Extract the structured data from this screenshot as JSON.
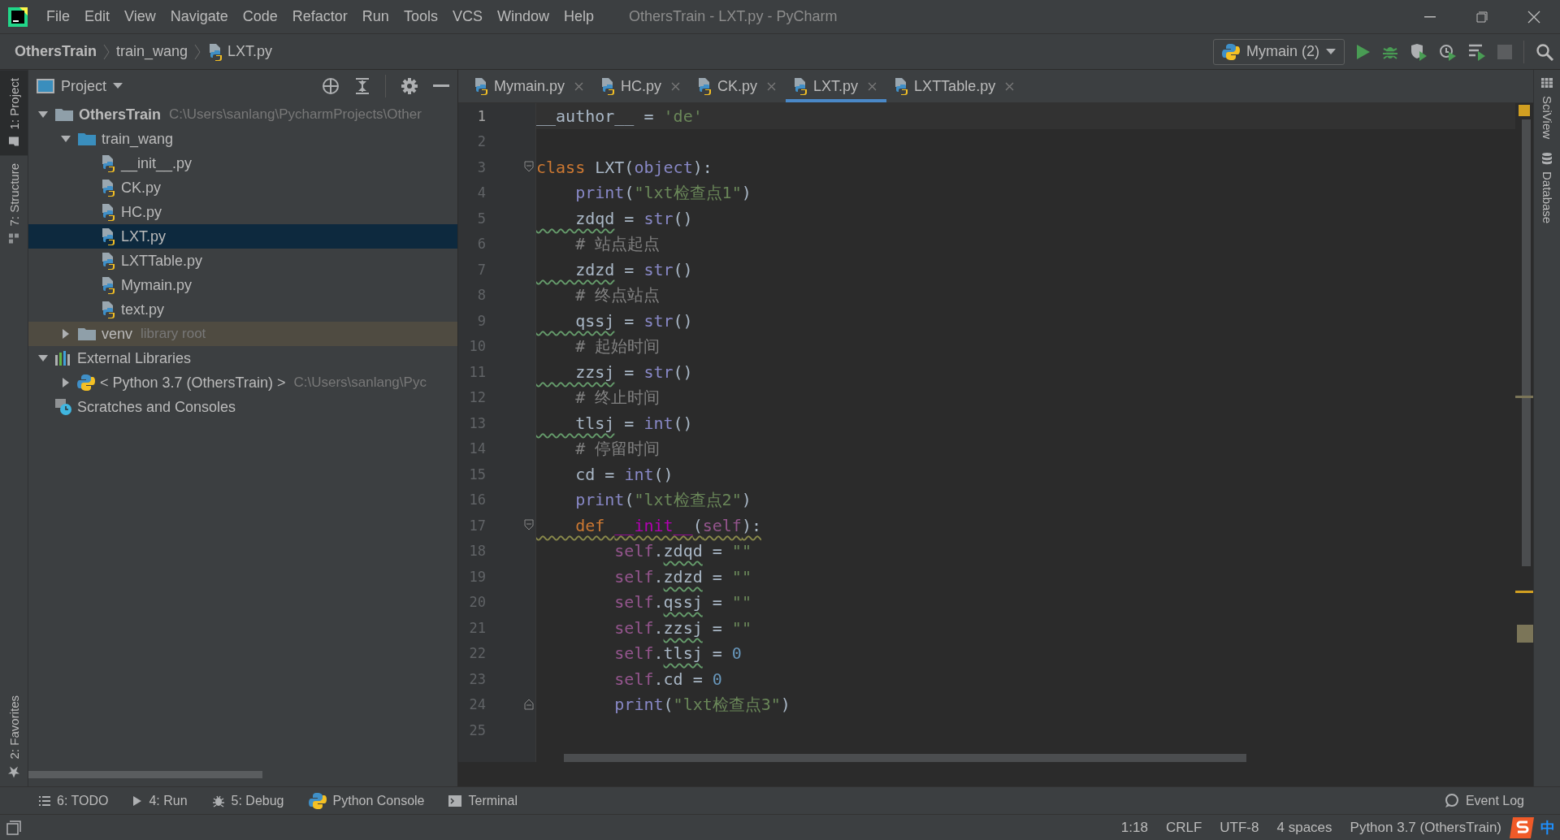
{
  "window": {
    "title": "OthersTrain - LXT.py - PyCharm"
  },
  "menu": [
    "File",
    "Edit",
    "View",
    "Navigate",
    "Code",
    "Refactor",
    "Run",
    "Tools",
    "VCS",
    "Window",
    "Help"
  ],
  "breadcrumbs": [
    {
      "label": "OthersTrain",
      "kind": "project"
    },
    {
      "label": "train_wang",
      "kind": "folder"
    },
    {
      "label": "LXT.py",
      "kind": "python-file"
    }
  ],
  "run_config": {
    "label": "Mymain (2)"
  },
  "left_tool_tabs": [
    {
      "label": "1: Project",
      "kind": "project",
      "selected": true
    },
    {
      "label": "7: Structure",
      "kind": "structure",
      "selected": false
    }
  ],
  "left_tool_tabs_bottom": [
    {
      "label": "2: Favorites",
      "kind": "favorites",
      "selected": false
    }
  ],
  "right_tool_tabs": [
    {
      "label": "SciView",
      "kind": "sciview"
    },
    {
      "label": "Database",
      "kind": "database"
    }
  ],
  "project_panel": {
    "title": "Project",
    "tree": [
      {
        "label": "OthersTrain",
        "hint": "C:\\Users\\sanlang\\PycharmProjects\\Other",
        "kind": "project",
        "expanded": true,
        "selected": false,
        "highlighted": false,
        "children": [
          {
            "label": "train_wang",
            "kind": "package",
            "expanded": true,
            "selected": false,
            "highlighted": false,
            "children": [
              {
                "label": "__init__.py",
                "kind": "python-file",
                "selected": false,
                "highlighted": false
              },
              {
                "label": "CK.py",
                "kind": "python-file",
                "selected": false,
                "highlighted": false
              },
              {
                "label": "HC.py",
                "kind": "python-file",
                "selected": false,
                "highlighted": false
              },
              {
                "label": "LXT.py",
                "kind": "python-file",
                "selected": true,
                "highlighted": false
              },
              {
                "label": "LXTTable.py",
                "kind": "python-file",
                "selected": false,
                "highlighted": false
              },
              {
                "label": "Mymain.py",
                "kind": "python-file",
                "selected": false,
                "highlighted": false
              },
              {
                "label": "text.py",
                "kind": "python-file",
                "selected": false,
                "highlighted": false
              }
            ]
          },
          {
            "label": "venv",
            "hint": "library root",
            "kind": "folder",
            "expanded": false,
            "selected": false,
            "highlighted": true
          }
        ]
      },
      {
        "label": "External Libraries",
        "kind": "libraries",
        "expanded": true,
        "selected": false,
        "highlighted": false,
        "children": [
          {
            "label": "< Python 3.7 (OthersTrain) >",
            "hint": "C:\\Users\\sanlang\\Pyc",
            "kind": "sdk",
            "expanded": false,
            "selected": false,
            "highlighted": false
          }
        ]
      },
      {
        "label": "Scratches and Consoles",
        "kind": "scratches",
        "selected": false,
        "highlighted": false
      }
    ]
  },
  "editor_tabs": [
    {
      "label": "Mymain.py",
      "selected": false
    },
    {
      "label": "HC.py",
      "selected": false
    },
    {
      "label": "CK.py",
      "selected": false
    },
    {
      "label": "LXT.py",
      "selected": true
    },
    {
      "label": "LXTTable.py",
      "selected": false
    }
  ],
  "editor": {
    "lines": [
      {
        "number": "1",
        "current": true,
        "kind": "plain",
        "tokens": [
          {
            "text": "__author__ = ",
            "kind": "plain"
          },
          {
            "text": "'de'",
            "kind": "string"
          }
        ]
      },
      {
        "number": "2",
        "current": false,
        "kind": "plain"
      },
      {
        "number": "3",
        "current": false,
        "kind": "fold-start",
        "tokens": [
          {
            "text": "class ",
            "kind": "keyword"
          },
          {
            "text": "LXT(",
            "kind": "plain"
          },
          {
            "text": "object",
            "kind": "builtin"
          },
          {
            "text": "):",
            "kind": "plain"
          }
        ]
      },
      {
        "number": "4",
        "current": false,
        "kind": "plain",
        "tokens": [
          {
            "text": "    print",
            "kind": "builtin"
          },
          {
            "text": "(",
            "kind": "plain"
          },
          {
            "text": "\"lxt检查点1\"",
            "kind": "string"
          },
          {
            "text": ")",
            "kind": "plain"
          }
        ]
      },
      {
        "number": "5",
        "current": false,
        "kind": "plain",
        "tokens": [
          {
            "text": "    zdqd",
            "kind": "typo"
          },
          {
            "text": " = ",
            "kind": "plain"
          },
          {
            "text": "str",
            "kind": "builtin"
          },
          {
            "text": "()",
            "kind": "plain"
          }
        ]
      },
      {
        "number": "6",
        "current": false,
        "kind": "plain",
        "tokens": [
          {
            "text": "    # 站点起点",
            "kind": "comment"
          }
        ]
      },
      {
        "number": "7",
        "current": false,
        "kind": "plain",
        "tokens": [
          {
            "text": "    zdzd",
            "kind": "typo"
          },
          {
            "text": " = ",
            "kind": "plain"
          },
          {
            "text": "str",
            "kind": "builtin"
          },
          {
            "text": "()",
            "kind": "plain"
          }
        ]
      },
      {
        "number": "8",
        "current": false,
        "kind": "plain",
        "tokens": [
          {
            "text": "    # 终点站点",
            "kind": "comment"
          }
        ]
      },
      {
        "number": "9",
        "current": false,
        "kind": "plain",
        "tokens": [
          {
            "text": "    qssj",
            "kind": "typo"
          },
          {
            "text": " = ",
            "kind": "plain"
          },
          {
            "text": "str",
            "kind": "builtin"
          },
          {
            "text": "()",
            "kind": "plain"
          }
        ]
      },
      {
        "number": "10",
        "current": false,
        "kind": "plain",
        "tokens": [
          {
            "text": "    # 起始时间",
            "kind": "comment"
          }
        ]
      },
      {
        "number": "11",
        "current": false,
        "kind": "plain",
        "tokens": [
          {
            "text": "    zzsj",
            "kind": "typo"
          },
          {
            "text": " = ",
            "kind": "plain"
          },
          {
            "text": "str",
            "kind": "builtin"
          },
          {
            "text": "()",
            "kind": "plain"
          }
        ]
      },
      {
        "number": "12",
        "current": false,
        "kind": "plain",
        "tokens": [
          {
            "text": "    # 终止时间",
            "kind": "comment"
          }
        ]
      },
      {
        "number": "13",
        "current": false,
        "kind": "plain",
        "tokens": [
          {
            "text": "    tlsj",
            "kind": "typo"
          },
          {
            "text": " = ",
            "kind": "plain"
          },
          {
            "text": "int",
            "kind": "builtin"
          },
          {
            "text": "()",
            "kind": "plain"
          }
        ]
      },
      {
        "number": "14",
        "current": false,
        "kind": "plain",
        "tokens": [
          {
            "text": "    # 停留时间",
            "kind": "comment"
          }
        ]
      },
      {
        "number": "15",
        "current": false,
        "kind": "plain",
        "tokens": [
          {
            "text": "    cd = ",
            "kind": "plain"
          },
          {
            "text": "int",
            "kind": "builtin"
          },
          {
            "text": "()",
            "kind": "plain"
          }
        ]
      },
      {
        "number": "16",
        "current": false,
        "kind": "plain",
        "tokens": [
          {
            "text": "    print",
            "kind": "builtin"
          },
          {
            "text": "(",
            "kind": "plain"
          },
          {
            "text": "\"lxt检查点2\"",
            "kind": "string"
          },
          {
            "text": ")",
            "kind": "plain"
          }
        ]
      },
      {
        "number": "17",
        "current": false,
        "kind": "fold-start",
        "tokens": [
          {
            "text": "    def ",
            "kind": "warn-keyword"
          },
          {
            "text": "__init__",
            "kind": "warn-magic"
          },
          {
            "text": "(",
            "kind": "warn-plain"
          },
          {
            "text": "self",
            "kind": "warn-self"
          },
          {
            "text": "):",
            "kind": "warn-plain"
          }
        ]
      },
      {
        "number": "18",
        "current": false,
        "kind": "plain",
        "tokens": [
          {
            "text": "        self",
            "kind": "self"
          },
          {
            "text": ".",
            "kind": "plain"
          },
          {
            "text": "zdqd",
            "kind": "typo"
          },
          {
            "text": " = ",
            "kind": "plain"
          },
          {
            "text": "\"\"",
            "kind": "string"
          }
        ]
      },
      {
        "number": "19",
        "current": false,
        "kind": "plain",
        "tokens": [
          {
            "text": "        self",
            "kind": "self"
          },
          {
            "text": ".",
            "kind": "plain"
          },
          {
            "text": "zdzd",
            "kind": "typo"
          },
          {
            "text": " = ",
            "kind": "plain"
          },
          {
            "text": "\"\"",
            "kind": "string"
          }
        ]
      },
      {
        "number": "20",
        "current": false,
        "kind": "plain",
        "tokens": [
          {
            "text": "        self",
            "kind": "self"
          },
          {
            "text": ".",
            "kind": "plain"
          },
          {
            "text": "qssj",
            "kind": "typo"
          },
          {
            "text": " = ",
            "kind": "plain"
          },
          {
            "text": "\"\"",
            "kind": "string"
          }
        ]
      },
      {
        "number": "21",
        "current": false,
        "kind": "plain",
        "tokens": [
          {
            "text": "        self",
            "kind": "self"
          },
          {
            "text": ".",
            "kind": "plain"
          },
          {
            "text": "zzsj",
            "kind": "typo"
          },
          {
            "text": " = ",
            "kind": "plain"
          },
          {
            "text": "\"\"",
            "kind": "string"
          }
        ]
      },
      {
        "number": "22",
        "current": false,
        "kind": "plain",
        "tokens": [
          {
            "text": "        self",
            "kind": "self"
          },
          {
            "text": ".",
            "kind": "plain"
          },
          {
            "text": "tlsj",
            "kind": "typo"
          },
          {
            "text": " = ",
            "kind": "plain"
          },
          {
            "text": "0",
            "kind": "number"
          }
        ]
      },
      {
        "number": "23",
        "current": false,
        "kind": "plain",
        "tokens": [
          {
            "text": "        self",
            "kind": "self"
          },
          {
            "text": ".cd = ",
            "kind": "plain"
          },
          {
            "text": "0",
            "kind": "number"
          }
        ]
      },
      {
        "number": "24",
        "current": false,
        "kind": "fold-end",
        "tokens": [
          {
            "text": "        print",
            "kind": "builtin"
          },
          {
            "text": "(",
            "kind": "plain"
          },
          {
            "text": "\"lxt检查点3\"",
            "kind": "string"
          },
          {
            "text": ")",
            "kind": "plain"
          }
        ]
      },
      {
        "number": "25",
        "current": false,
        "kind": "plain"
      }
    ]
  },
  "bottom_tools": [
    {
      "label": "6: TODO",
      "kind": "todo"
    },
    {
      "label": "4: Run",
      "kind": "run"
    },
    {
      "label": "5: Debug",
      "kind": "debug"
    },
    {
      "label": "Python Console",
      "kind": "python"
    },
    {
      "label": "Terminal",
      "kind": "terminal"
    }
  ],
  "event_log": {
    "label": "Event Log"
  },
  "status_bar": {
    "items": [
      "1:18",
      "CRLF",
      "UTF-8",
      "4 spaces",
      "Python 3.7 (OthersTrain)"
    ],
    "ime": "中"
  }
}
